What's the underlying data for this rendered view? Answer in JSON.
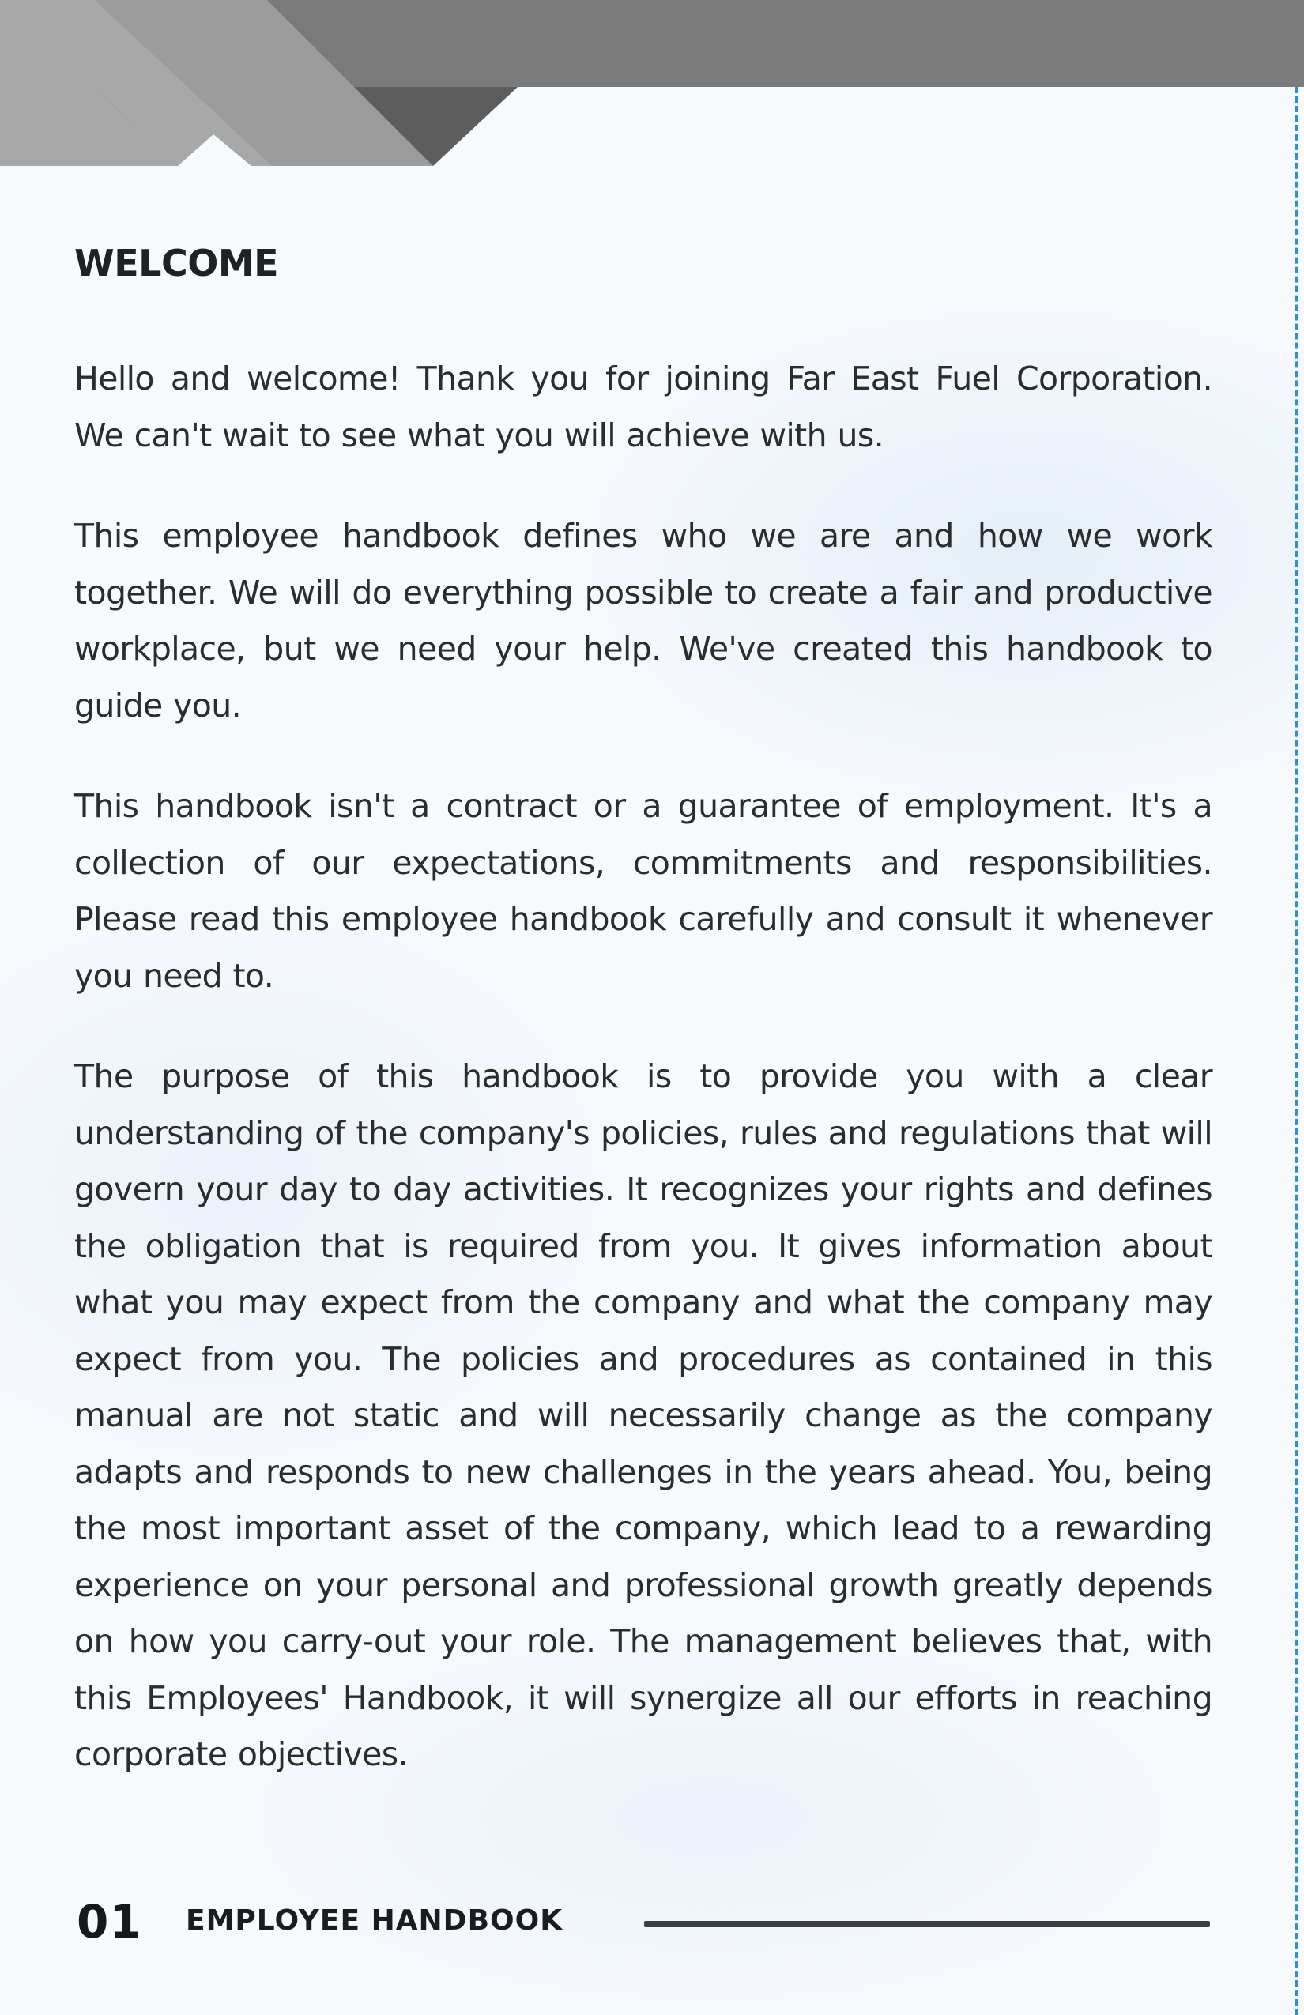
{
  "header": {
    "colors": {
      "band": "#7a7a7a",
      "stripe_light": "#a9a9a9",
      "stripe_dark": "#5a5a5a"
    }
  },
  "main": {
    "heading": "WELCOME",
    "paragraphs": [
      "Hello and welcome! Thank you for joining Far East Fuel Corporation. We can't wait to see what you will achieve with us.",
      "This employee handbook defines who we are and how we work together. We will do everything possible to create a fair and productive workplace, but we need your help. We've created this handbook to guide you.",
      "This handbook isn't a contract or a guarantee of employment. It's a collection of our expectations, commitments and responsibilities. Please read this employee handbook carefully and consult it whenever you need to.",
      "The purpose of this handbook is to provide you with a clear understanding of the company's policies, rules and regulations that will govern your day to day activities. It recognizes your rights and defines the obligation that is required from you. It gives information about what you may expect from the company and what the company may expect from you. The policies and procedures as contained in this manual are not static and will necessarily change as the company adapts and responds to new challenges in the years ahead. You, being the most important asset of the company, which lead to a rewarding experience on your personal and professional growth greatly depends on how you carry-out your role. The management believes that, with this Employees' Handbook, it will synergize all our efforts in reaching corporate objectives."
    ]
  },
  "footer": {
    "page_number": "01",
    "title": "EMPLOYEE HANDBOOK"
  },
  "accent_color": "#2d8fd6"
}
